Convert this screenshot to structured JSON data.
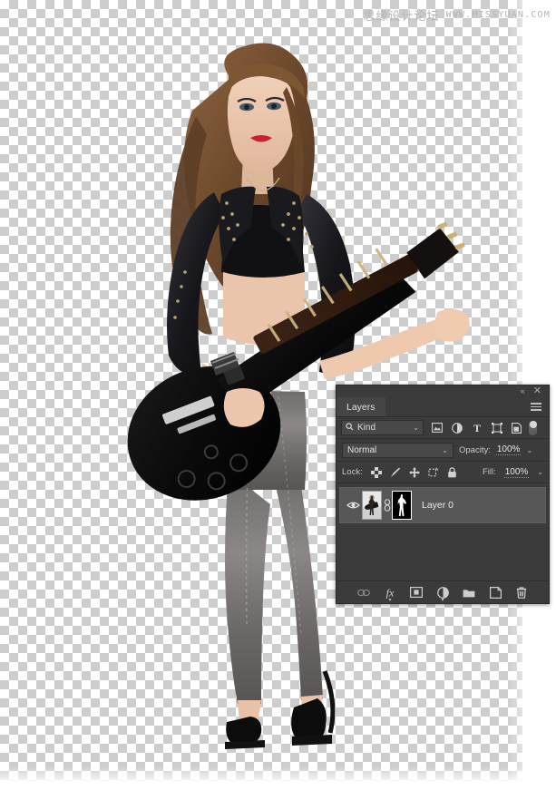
{
  "watermark": {
    "cn_text": "思缘设计论坛",
    "en_text": "WWW.MISSYUAN.COM"
  },
  "canvas": {
    "name": "transparent-checkerboard-canvas",
    "subject_description": "Woman with long brown hair in black studded leather jacket, black crop top, grey acid-wash jeans and black high heels, holding a black Les Paul electric guitar",
    "transparency_light": "#ffffff",
    "transparency_dark": "#cdcdcd"
  },
  "layers_panel": {
    "title": "Layers",
    "collapse_icon": "«",
    "close_icon": "✕",
    "menu_icon": "hamburger-icon",
    "filter": {
      "search_icon": "search-icon",
      "kind_label": "Kind",
      "caret": "⌄",
      "icons": [
        {
          "name": "filter-pixel-layers-icon",
          "title": "Pixel layers"
        },
        {
          "name": "filter-adjustment-layers-icon",
          "title": "Adjustment layers"
        },
        {
          "name": "filter-type-layers-icon",
          "title": "Type layers"
        },
        {
          "name": "filter-shape-layers-icon",
          "title": "Shape layers"
        },
        {
          "name": "filter-smart-objects-icon",
          "title": "Smart objects"
        }
      ],
      "toggle_name": "filter-enable-toggle"
    },
    "blend": {
      "mode": "Normal",
      "opacity_label": "Opacity:",
      "opacity_value": "100%",
      "caret": "⌄"
    },
    "lock": {
      "label": "Lock:",
      "icons": [
        {
          "name": "lock-transparent-pixels-icon"
        },
        {
          "name": "lock-image-pixels-icon"
        },
        {
          "name": "lock-position-icon"
        },
        {
          "name": "lock-artboard-nesting-icon"
        },
        {
          "name": "lock-all-icon"
        }
      ],
      "fill_label": "Fill:",
      "fill_value": "100%",
      "caret": "⌄"
    },
    "layers": [
      {
        "name": "Layer 0",
        "visible": true,
        "eye_icon": "eye-icon",
        "link_icon": "link-mask-icon",
        "thumbnail": "layer-thumbnail",
        "mask_thumbnail": "layer-mask-thumbnail",
        "mask_selected": true
      }
    ],
    "footer_buttons": [
      {
        "name": "link-layers-button",
        "glyph": "⚭",
        "disabled": true
      },
      {
        "name": "layer-style-fx-button",
        "glyph": "fx",
        "has_caret": true
      },
      {
        "name": "add-layer-mask-button",
        "glyph": "mask-icon",
        "disabled": false
      },
      {
        "name": "new-adjustment-layer-button",
        "glyph": "half-circle-icon",
        "has_caret": true
      },
      {
        "name": "new-group-button",
        "glyph": "folder-icon",
        "disabled": false
      },
      {
        "name": "new-layer-button",
        "glyph": "new-layer-icon",
        "disabled": false
      },
      {
        "name": "delete-layer-button",
        "glyph": "trash-icon",
        "disabled": false
      }
    ],
    "colors": {
      "panel_bg": "#3b3b3b",
      "row_selected_bg": "#575757",
      "field_bg": "#484848",
      "text": "#d3d3d3"
    }
  }
}
